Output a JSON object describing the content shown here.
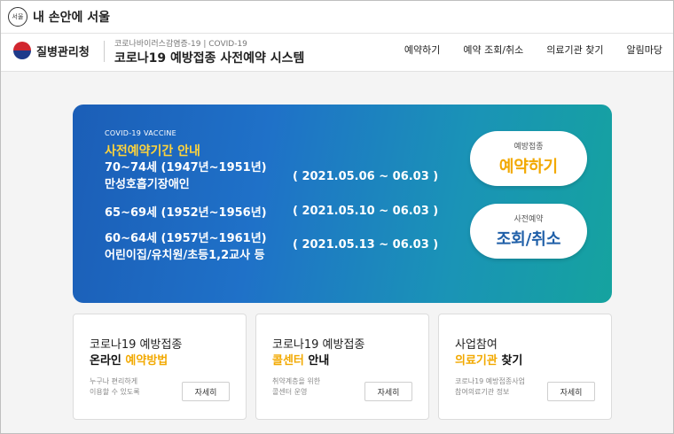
{
  "seoul": {
    "logo_text": "서울",
    "title": "내 손안에 서울"
  },
  "header": {
    "org_name": "질병관리청",
    "subtitle": "코로나바이러스감염증-19 | COVID-19",
    "title": "코로나19 예방접종 사전예약 시스템",
    "nav": [
      "예약하기",
      "예약 조회/취소",
      "의료기관 찾기",
      "알림마당"
    ]
  },
  "banner": {
    "eyebrow": "COVID-19 VACCINE",
    "heading": "사전예약기간 안내",
    "groups": [
      {
        "line1": "70~74세 (1947년~1951년)",
        "line2": "만성호흡기장애인",
        "date": "( 2021.05.06 ~ 06.03 )"
      },
      {
        "line1": "65~69세 (1952년~1956년)",
        "line2": "",
        "date": "( 2021.05.10 ~ 06.03 )"
      },
      {
        "line1": "60~64세 (1957년~1961년)",
        "line2": "어린이집/유치원/초등1,2교사 등",
        "date": "( 2021.05.13 ~ 06.03 )"
      }
    ],
    "reserve": {
      "small": "예방접종",
      "big": "예약하기",
      "color": "#f2a900"
    },
    "lookup": {
      "small": "사전예약",
      "big": "조회/취소",
      "color": "#1f5fa8"
    }
  },
  "cards": [
    {
      "line1": "코로나19 예방접종",
      "line2_a": "온라인 ",
      "line2_hl": "예약방법",
      "line2_b": "",
      "desc1": "누구나 편리하게",
      "desc2": "이용할 수 있도록",
      "button": "자세히"
    },
    {
      "line1": "코로나19 예방접종",
      "line2_a": "",
      "line2_hl": "콜센터",
      "line2_b": " 안내",
      "desc1": "취약계층을 위한",
      "desc2": "콜센터 운영",
      "button": "자세히"
    },
    {
      "line1": "사업참여",
      "line2_a": "",
      "line2_hl": "의료기관",
      "line2_b": " 찾기",
      "desc1": "코로나19 예방접종사업",
      "desc2": "참여의료기관 정보",
      "button": "자세히"
    }
  ],
  "colors": {
    "accent": "#f2a900",
    "banner_start": "#1b5eb7",
    "banner_end": "#15a39f"
  }
}
